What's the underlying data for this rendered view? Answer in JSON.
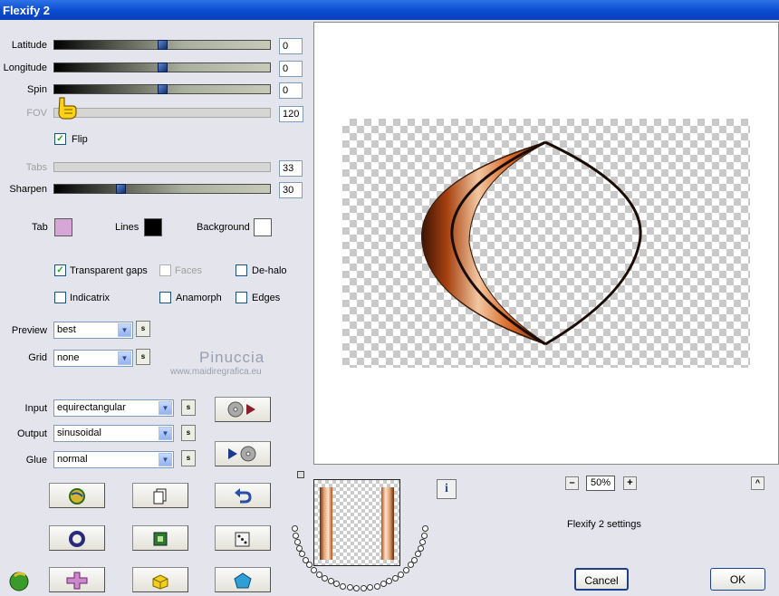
{
  "window": {
    "title": "Flexify 2"
  },
  "sliders": [
    {
      "label": "Latitude",
      "value": "0",
      "level": 0.5,
      "enabled": true
    },
    {
      "label": "Longitude",
      "value": "0",
      "level": 0.5,
      "enabled": true
    },
    {
      "label": "Spin",
      "value": "0",
      "level": 0.5,
      "enabled": true
    },
    {
      "label": "FOV",
      "value": "120",
      "level": 0.0,
      "enabled": false
    },
    {
      "label": "Tabs",
      "value": "33",
      "level": 0.33,
      "enabled": false
    },
    {
      "label": "Sharpen",
      "value": "30",
      "level": 0.3,
      "enabled": true
    }
  ],
  "flip": {
    "label": "Flip",
    "checked": true
  },
  "colors": {
    "tab": {
      "label": "Tab",
      "color": "#d6a6d6"
    },
    "lines": {
      "label": "Lines",
      "color": "#000000"
    },
    "background": {
      "label": "Background",
      "color": "#ffffff"
    }
  },
  "checkboxes": {
    "transparent_gaps": {
      "label": "Transparent gaps",
      "checked": true
    },
    "faces": {
      "label": "Faces",
      "checked": false
    },
    "de_halo": {
      "label": "De-halo",
      "checked": false
    },
    "indicatrix": {
      "label": "Indicatrix",
      "checked": false
    },
    "anamorph": {
      "label": "Anamorph",
      "checked": false
    },
    "edges": {
      "label": "Edges",
      "checked": false
    }
  },
  "preview": {
    "label": "Preview",
    "value": "best"
  },
  "grid": {
    "label": "Grid",
    "value": "none"
  },
  "save_button": "s",
  "watermark": {
    "line1": "Pinuccia",
    "line2": "www.maidiregrafica.eu"
  },
  "input": {
    "label": "Input",
    "value": "equirectangular"
  },
  "output": {
    "label": "Output",
    "value": "sinusoidal"
  },
  "glue": {
    "label": "Glue",
    "value": "normal"
  },
  "zoom": {
    "value": "50%",
    "minus": "–",
    "plus": "+"
  },
  "info_label": "i",
  "collapse_label": "^",
  "settings_label": "Flexify 2 settings",
  "buttons": {
    "cancel": "Cancel",
    "ok": "OK"
  },
  "accent": "#0a4bd0"
}
